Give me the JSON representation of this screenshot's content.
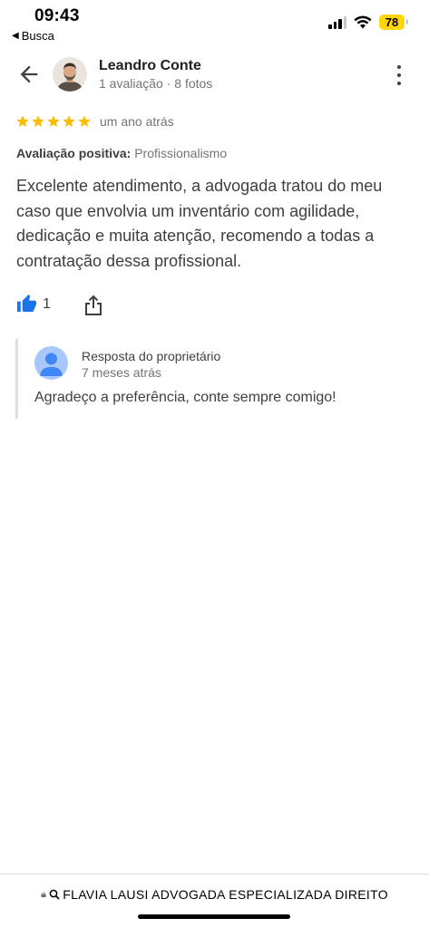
{
  "status_bar": {
    "time": "09:43",
    "back_app_label": "Busca",
    "battery_level": "78"
  },
  "header": {
    "reviewer_name": "Leandro Conte",
    "reviewer_meta": "1 avaliação · 8 fotos"
  },
  "review": {
    "rating": 5,
    "max_rating": 5,
    "time_ago": "um ano atrás",
    "positive_label": "Avaliação positiva:",
    "positive_value": "Profissionalismo",
    "text": "Excelente atendimento, a advogada tratou do meu caso que envolvia um inventário com agilidade, dedicação e muita atenção, recomendo a todas a contratação dessa profissional.",
    "like_count": "1"
  },
  "owner_response": {
    "title": "Resposta do proprietário",
    "time_ago": "7 meses atrás",
    "text": "Agradeço a preferência, conte sempre comigo!"
  },
  "browser": {
    "url": "FLAVIA LAUSI ADVOGADA ESPECIALIZADA DIREITO"
  },
  "colors": {
    "star": "#fbbc04",
    "like_blue": "#1a73e8",
    "battery": "#ffd60a",
    "owner_avatar_bg": "#a8c7fa",
    "owner_avatar_fg": "#4285f4"
  },
  "icons": {
    "back": "arrow-left-icon",
    "more": "more-vert-icon",
    "like": "thumb-up-icon",
    "share": "share-icon",
    "lock": "lock-icon",
    "search": "search-icon"
  }
}
